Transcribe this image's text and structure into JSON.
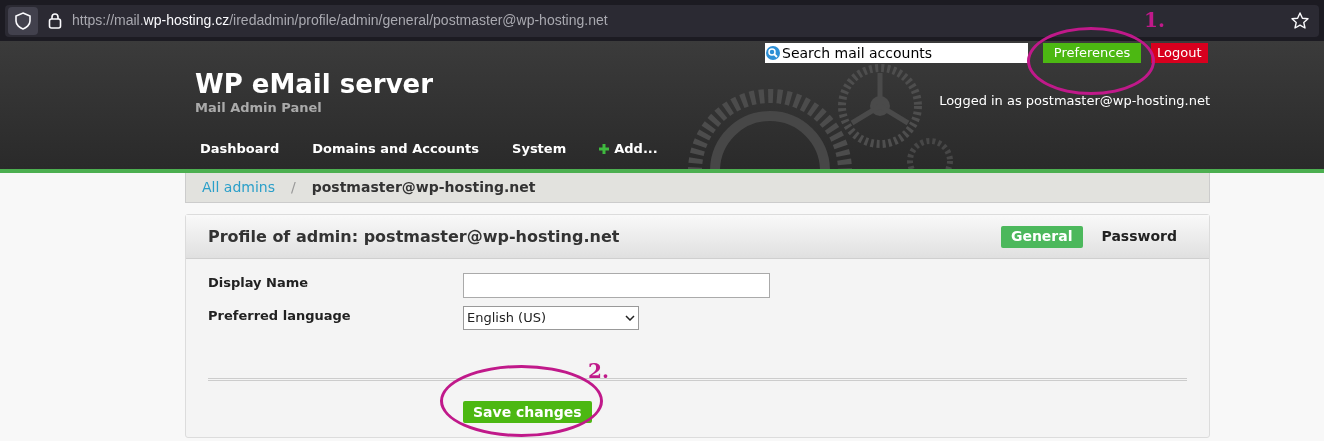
{
  "browser": {
    "url": {
      "prefix": "https://mail.",
      "domain": "wp-hosting.cz",
      "path": "/iredadmin/profile/admin/general/postmaster@wp-hosting.net"
    }
  },
  "header": {
    "title": "WP eMail server",
    "subtitle": "Mail Admin Panel",
    "search": {
      "placeholder": "Search mail accounts"
    },
    "buttons": [
      {
        "label": "Preferences",
        "kind": "preferences"
      },
      {
        "label": "Logout",
        "kind": "logout"
      }
    ],
    "logged_in": "Logged in as postmaster@wp-hosting.net",
    "nav": [
      {
        "label": "Dashboard",
        "kind": "plain"
      },
      {
        "label": "Domains and Accounts",
        "kind": "plain"
      },
      {
        "label": "System",
        "kind": "plain"
      },
      {
        "label": "Add...",
        "kind": "add"
      }
    ]
  },
  "breadcrumb": [
    {
      "label": "All admins",
      "kind": "link"
    },
    {
      "label": "/",
      "kind": "separator"
    },
    {
      "label": "postmaster@wp-hosting.net",
      "kind": "current"
    }
  ],
  "panel": {
    "title": "Profile of admin: postmaster@wp-hosting.net",
    "tabs": [
      {
        "label": "General",
        "selected": true
      },
      {
        "label": "Password",
        "selected": false
      }
    ],
    "fields": [
      {
        "label": "Display Name",
        "kind": "text"
      },
      {
        "label": "Preferred language",
        "kind": "select",
        "value": "English (US)"
      }
    ],
    "submit": "Save changes"
  },
  "annotations": [
    {
      "label": "1."
    },
    {
      "label": "2."
    }
  ]
}
